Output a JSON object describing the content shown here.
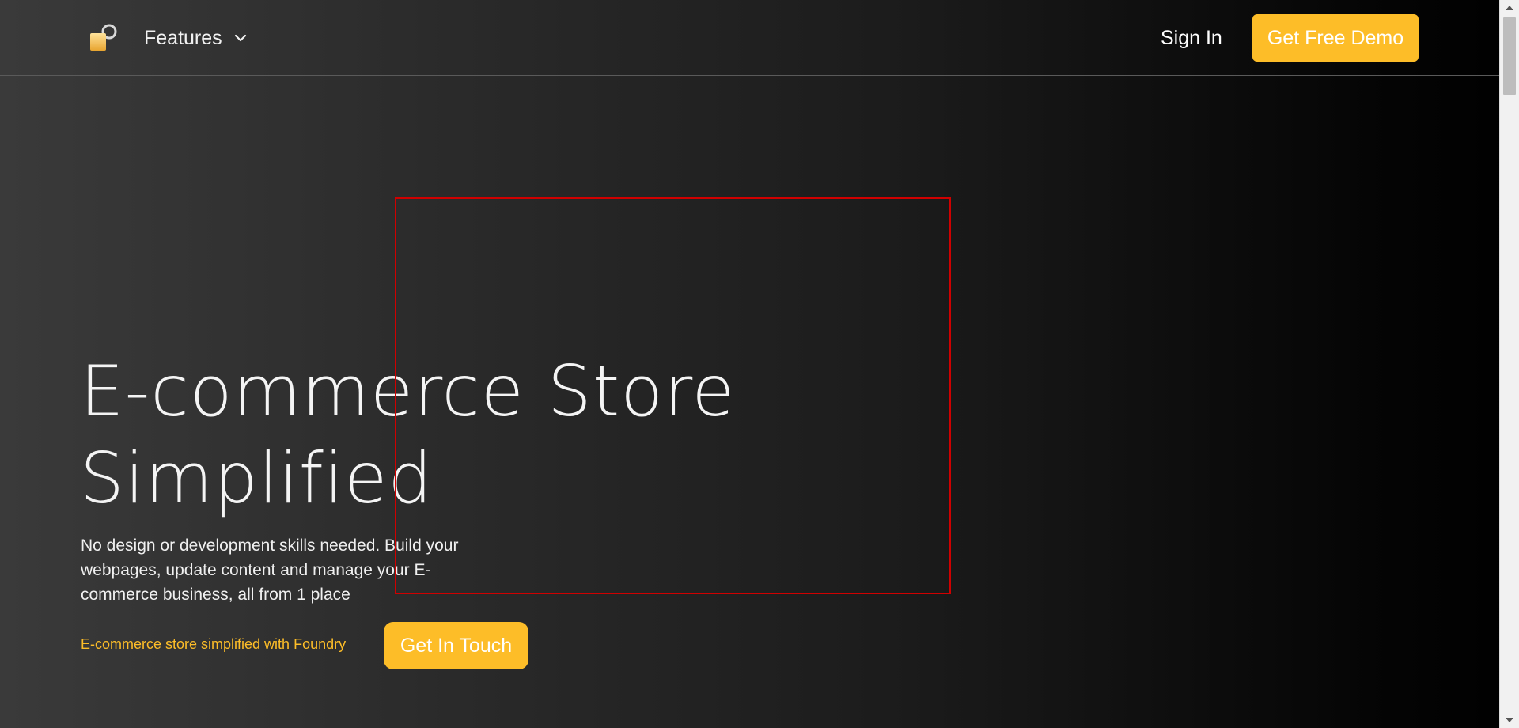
{
  "header": {
    "logo_icon": "lock-logo-icon",
    "nav_features_label": "Features",
    "nav_features_icon": "chevron-down-icon",
    "sign_in_label": "Sign In",
    "demo_button_label": "Get Free Demo"
  },
  "hero": {
    "title_line1": "E-commerce Store",
    "title_line2": "Simplified",
    "description": "No design or development skills needed. Build your webpages, update content and manage your E-commerce business, all from 1 place",
    "tagline": "E-commerce store simplified with Foundry",
    "cta_label": "Get In Touch"
  },
  "colors": {
    "accent": "#fdbd28",
    "highlight_border": "#d00000",
    "text": "#f4f4f4"
  }
}
